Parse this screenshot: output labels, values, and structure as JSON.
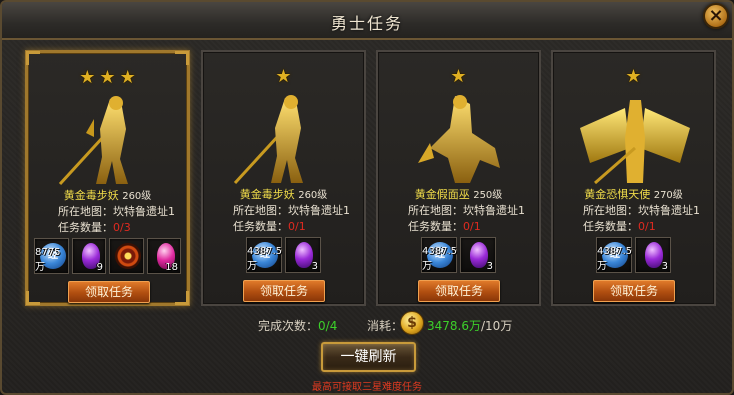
{
  "window": {
    "title": "勇士任务",
    "close_label": "×"
  },
  "labels": {
    "map_prefix": "所在地图：",
    "count_prefix": "任务数量：",
    "claim_button": "领取任务"
  },
  "cards": [
    {
      "stars": 3,
      "monster_name": "黄金毒步妖",
      "level": "260级",
      "map": "坎特鲁遗址1",
      "count": "0/3",
      "rewards": [
        {
          "icon": "exp-orb-icon",
          "qty": "8775万"
        },
        {
          "icon": "purple-gem-icon",
          "qty": "9"
        },
        {
          "icon": "fire-eye-icon",
          "qty": ""
        },
        {
          "icon": "pink-gem-icon",
          "qty": "18"
        }
      ]
    },
    {
      "stars": 1,
      "monster_name": "黄金毒步妖",
      "level": "260级",
      "map": "坎特鲁遗址1",
      "count": "0/1",
      "rewards": [
        {
          "icon": "exp-orb-icon",
          "qty": "4387.5万"
        },
        {
          "icon": "purple-gem-icon",
          "qty": "3"
        }
      ]
    },
    {
      "stars": 1,
      "monster_name": "黄金假面巫",
      "level": "250级",
      "map": "坎特鲁遗址1",
      "count": "0/1",
      "rewards": [
        {
          "icon": "exp-orb-icon",
          "qty": "4387.5万"
        },
        {
          "icon": "purple-gem-icon",
          "qty": "3"
        }
      ]
    },
    {
      "stars": 1,
      "monster_name": "黄金恐惧天使",
      "level": "270级",
      "map": "坎特鲁遗址1",
      "count": "0/1",
      "rewards": [
        {
          "icon": "exp-orb-icon",
          "qty": "4387.5万"
        },
        {
          "icon": "purple-gem-icon",
          "qty": "3"
        }
      ]
    }
  ],
  "footer": {
    "completed_label": "完成次数：",
    "completed_value": "0/4",
    "cost_label": "消耗：",
    "cost_current": "3478.6万",
    "cost_total": "/10万",
    "refresh_button": "一键刷新",
    "hint": "最高可接取三星难度任务"
  },
  "colors": {
    "accent_gold": "#c89a3a",
    "monster_name": "#f0dc4a",
    "progress_red": "#e02a20",
    "value_green": "#3cd02a",
    "button_orange": "#b04e10"
  }
}
